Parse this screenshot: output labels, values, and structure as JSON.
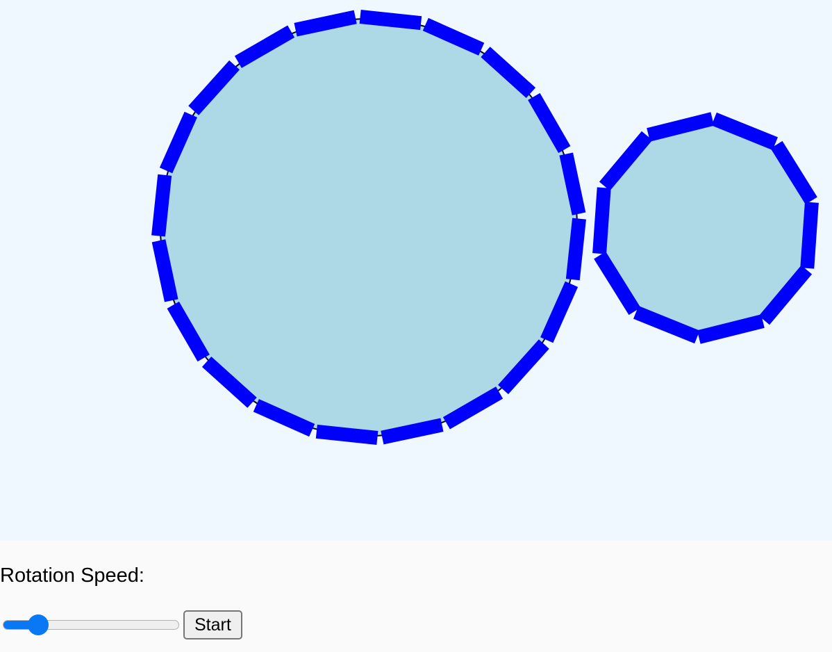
{
  "colors": {
    "canvas_background": "#f0f8ff",
    "gear_fill": "#add8e6",
    "gear_teeth": "#0000ff",
    "gear_outline": "#000000",
    "slider_accent": "#0a78f5"
  },
  "gears": [
    {
      "name": "large-gear",
      "teeth": 20,
      "rotation_deg": 6
    },
    {
      "name": "small-gear",
      "teeth": 10,
      "rotation_deg": 4
    }
  ],
  "controls": {
    "speed_label": "Rotation Speed:",
    "speed_value": 0.16,
    "start_label": "Start"
  }
}
